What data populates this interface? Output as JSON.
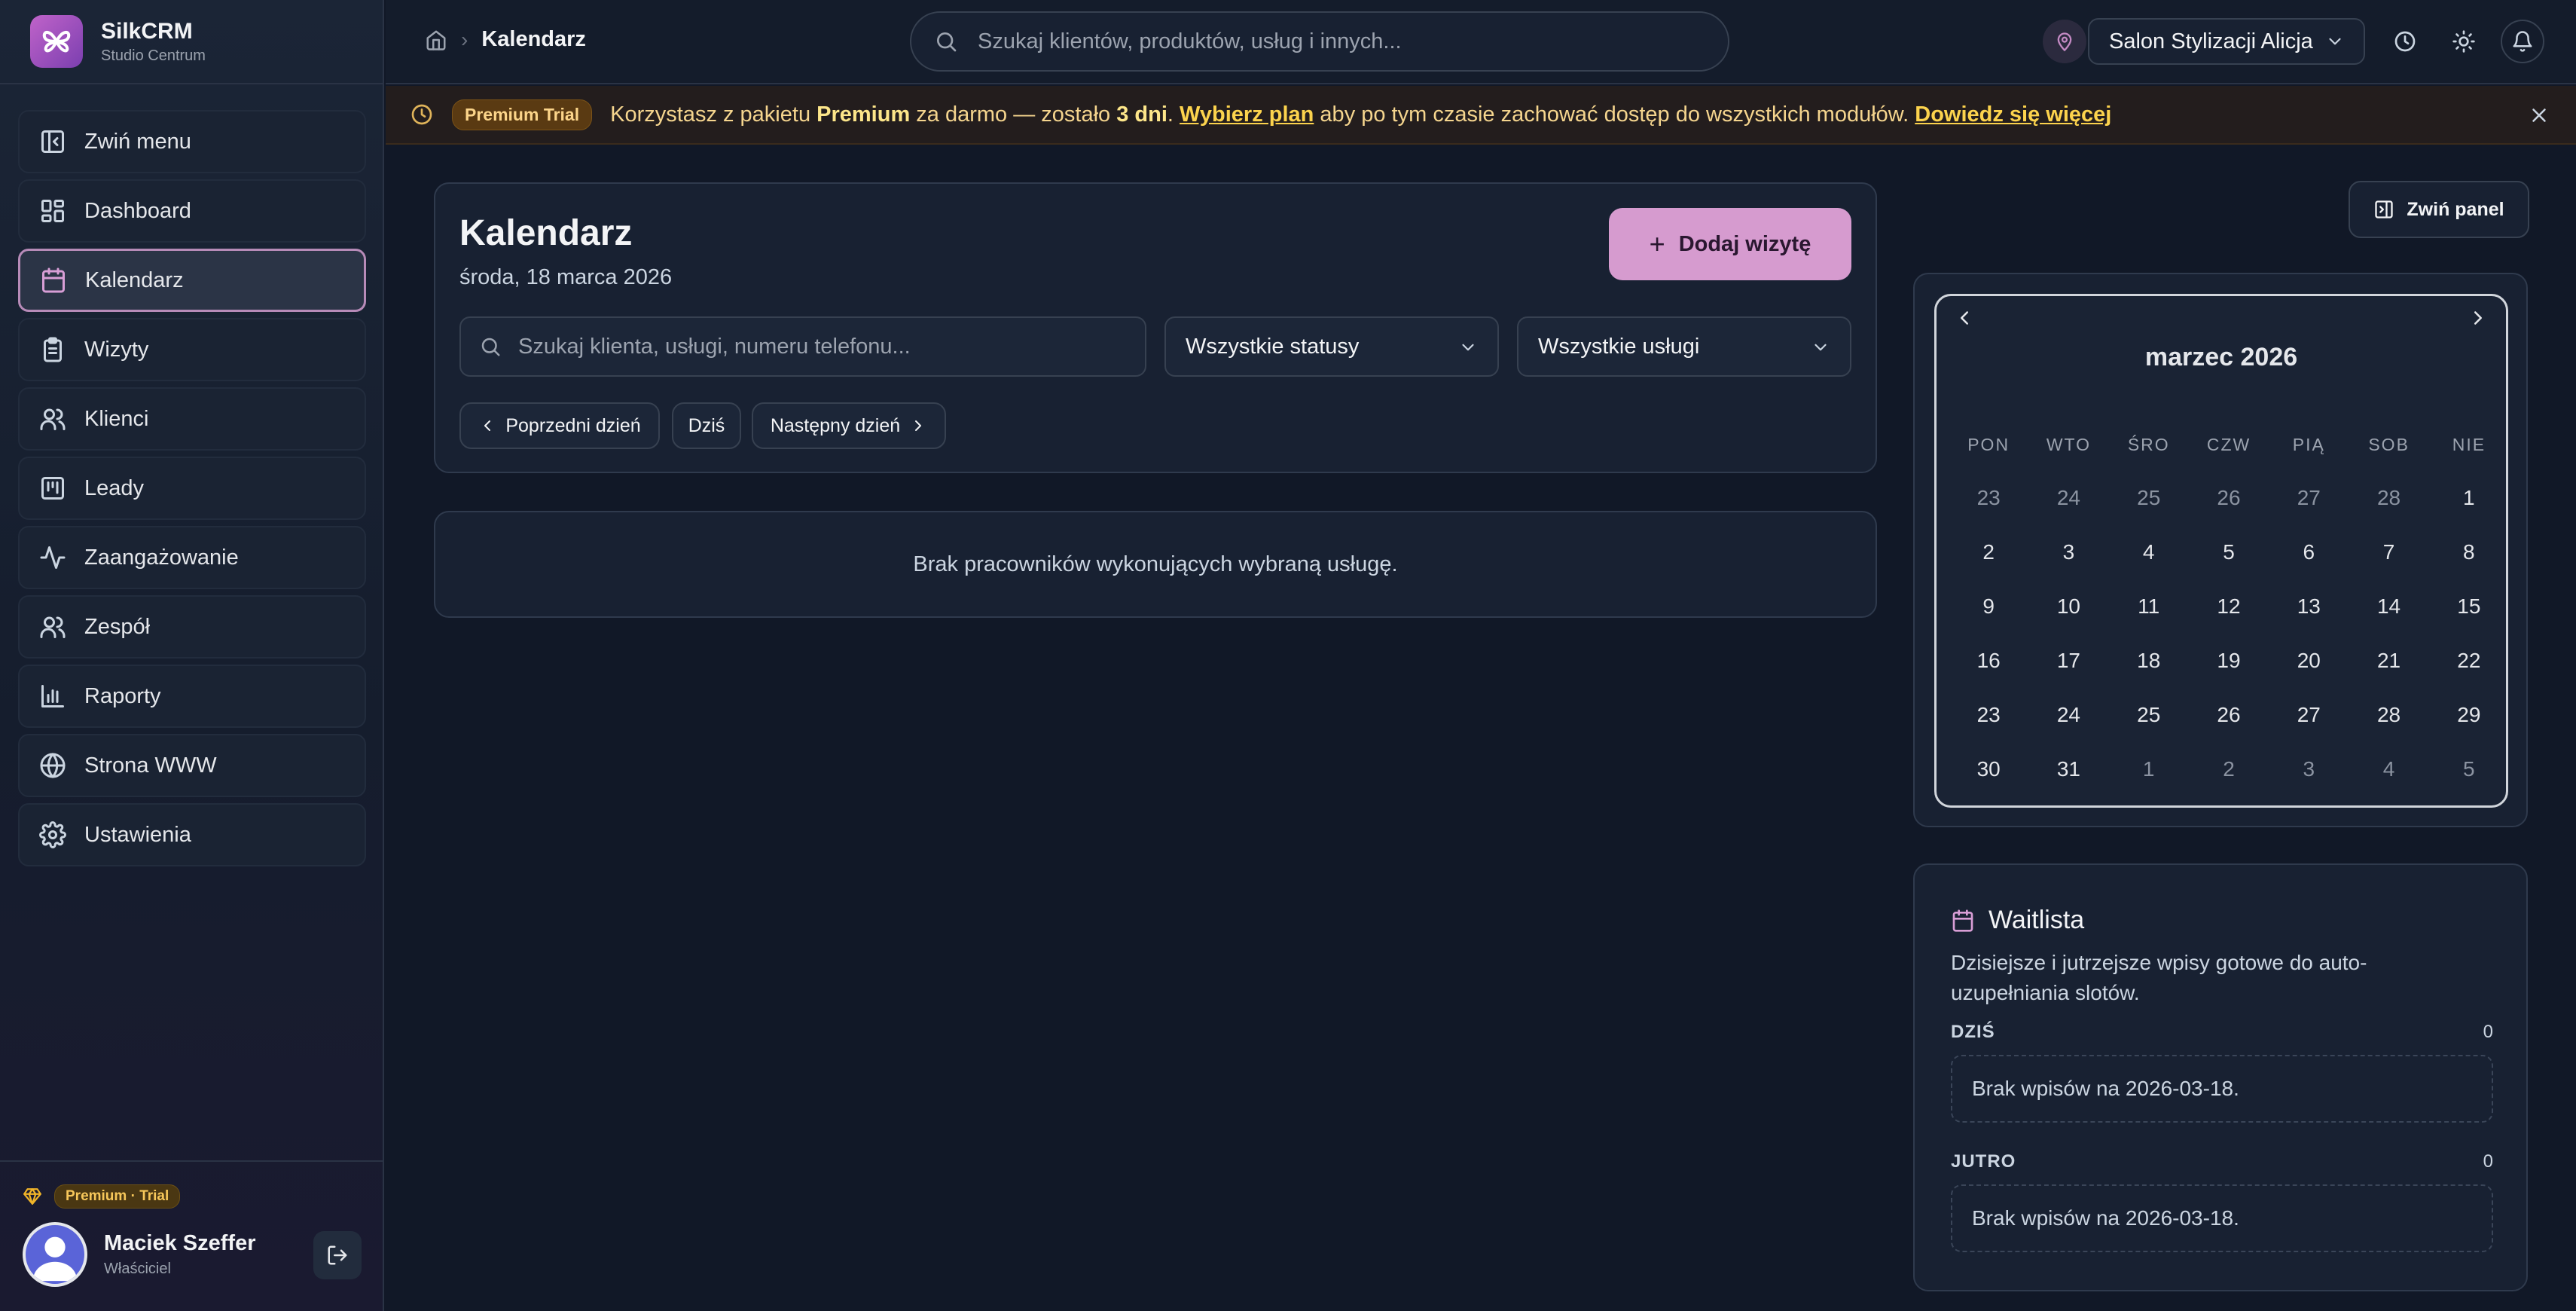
{
  "app": {
    "name": "SilkCRM",
    "subtitle": "Studio Centrum"
  },
  "sidebar": {
    "items": [
      {
        "label": "Zwiń menu",
        "icon": "collapse-sidebar-icon"
      },
      {
        "label": "Dashboard",
        "icon": "dashboard-icon"
      },
      {
        "label": "Kalendarz",
        "icon": "calendar-icon",
        "active": true
      },
      {
        "label": "Wizyty",
        "icon": "clipboard-icon"
      },
      {
        "label": "Klienci",
        "icon": "users-icon"
      },
      {
        "label": "Leady",
        "icon": "kanban-icon"
      },
      {
        "label": "Zaangażowanie",
        "icon": "activity-icon"
      },
      {
        "label": "Zespół",
        "icon": "team-icon"
      },
      {
        "label": "Raporty",
        "icon": "bar-chart-icon"
      },
      {
        "label": "Strona WWW",
        "icon": "globe-icon"
      },
      {
        "label": "Ustawienia",
        "icon": "gear-icon"
      }
    ],
    "plan_badge": "Premium · Trial",
    "user": {
      "name": "Maciek Szeffer",
      "role": "Właściciel"
    }
  },
  "topbar": {
    "breadcrumb_current": "Kalendarz",
    "search_placeholder": "Szukaj klientów, produktów, usług i innych...",
    "salon": "Salon Stylizacji Alicja"
  },
  "banner": {
    "pill": "Premium Trial",
    "text_1": "Korzystasz z pakietu ",
    "plan": "Premium",
    "text_2": " za darmo — zostało ",
    "days": "3 dni",
    "text_3": ". ",
    "link_plan": "Wybierz plan",
    "text_4": " aby po tym czasie zachować dostęp do wszystkich modułów. ",
    "link_more": "Dowiedz się więcej"
  },
  "main": {
    "title": "Kalendarz",
    "date": "środa, 18 marca 2026",
    "add_button": "Dodaj wizytę",
    "search_placeholder": "Szukaj klienta, usługi, numeru telefonu...",
    "status_filter": "Wszystkie statusy",
    "service_filter": "Wszystkie usługi",
    "prev_day": "Poprzedni dzień",
    "today": "Dziś",
    "next_day": "Następny dzień",
    "empty_message": "Brak pracowników wykonujących wybraną usługę."
  },
  "panel": {
    "collapse_button": "Zwiń panel",
    "calendar": {
      "month_title": "marzec 2026",
      "weekdays": [
        "PON",
        "WTO",
        "ŚRO",
        "CZW",
        "PIĄ",
        "SOB",
        "NIE"
      ],
      "weeks": [
        [
          {
            "d": "23",
            "m": true
          },
          {
            "d": "24",
            "m": true
          },
          {
            "d": "25",
            "m": true
          },
          {
            "d": "26",
            "m": true
          },
          {
            "d": "27",
            "m": true
          },
          {
            "d": "28",
            "m": true
          },
          {
            "d": "1",
            "m": false
          }
        ],
        [
          {
            "d": "2",
            "m": false
          },
          {
            "d": "3",
            "m": false
          },
          {
            "d": "4",
            "m": false
          },
          {
            "d": "5",
            "m": false
          },
          {
            "d": "6",
            "m": false
          },
          {
            "d": "7",
            "m": false
          },
          {
            "d": "8",
            "m": false
          }
        ],
        [
          {
            "d": "9",
            "m": false
          },
          {
            "d": "10",
            "m": false
          },
          {
            "d": "11",
            "m": false
          },
          {
            "d": "12",
            "m": false
          },
          {
            "d": "13",
            "m": false
          },
          {
            "d": "14",
            "m": false
          },
          {
            "d": "15",
            "m": false
          }
        ],
        [
          {
            "d": "16",
            "m": false
          },
          {
            "d": "17",
            "m": false
          },
          {
            "d": "18",
            "m": false
          },
          {
            "d": "19",
            "m": false
          },
          {
            "d": "20",
            "m": false
          },
          {
            "d": "21",
            "m": false
          },
          {
            "d": "22",
            "m": false
          }
        ],
        [
          {
            "d": "23",
            "m": false
          },
          {
            "d": "24",
            "m": false
          },
          {
            "d": "25",
            "m": false
          },
          {
            "d": "26",
            "m": false
          },
          {
            "d": "27",
            "m": false
          },
          {
            "d": "28",
            "m": false
          },
          {
            "d": "29",
            "m": false
          }
        ],
        [
          {
            "d": "30",
            "m": false
          },
          {
            "d": "31",
            "m": false
          },
          {
            "d": "1",
            "m": true
          },
          {
            "d": "2",
            "m": true
          },
          {
            "d": "3",
            "m": true
          },
          {
            "d": "4",
            "m": true
          },
          {
            "d": "5",
            "m": true
          }
        ]
      ]
    },
    "waitlist": {
      "title": "Waitlista",
      "description": "Dzisiejsze i jutrzejsze wpisy gotowe do auto-uzupełniania slotów.",
      "today_label": "DZIŚ",
      "today_count": "0",
      "today_empty": "Brak wpisów na 2026-03-18.",
      "tomorrow_label": "JUTRO",
      "tomorrow_count": "0",
      "tomorrow_empty": "Brak wpisów na 2026-03-18."
    }
  },
  "colors": {
    "accent": "#d69bcf",
    "banner_text": "#f5d58e",
    "background": "#111827"
  }
}
